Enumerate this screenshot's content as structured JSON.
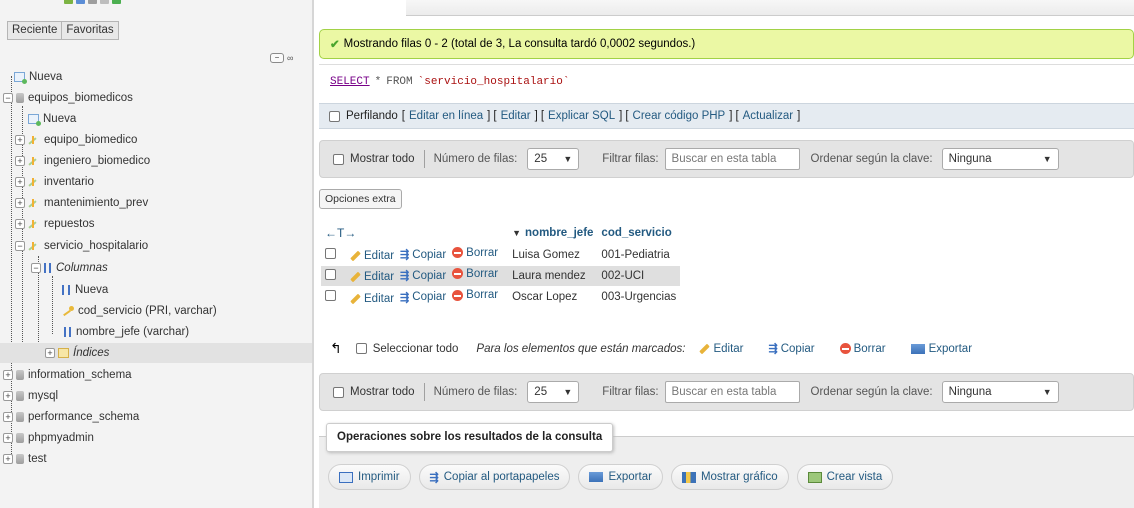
{
  "nav": {
    "tabs": [
      "Reciente",
      "Favoritas"
    ],
    "link_icon": "∞",
    "collapse_icon": "−",
    "tree": [
      {
        "label": "Nueva",
        "icon": "new-icon"
      },
      {
        "label": "equipos_biomedicos",
        "icon": "database-icon"
      },
      {
        "label": "Nueva",
        "icon": "new-icon"
      },
      {
        "label": "equipo_biomedico",
        "icon": "table-icon"
      },
      {
        "label": "ingeniero_biomedico",
        "icon": "table-icon"
      },
      {
        "label": "inventario",
        "icon": "table-icon"
      },
      {
        "label": "mantenimiento_prev",
        "icon": "table-icon"
      },
      {
        "label": "repuestos",
        "icon": "table-icon"
      },
      {
        "label": "servicio_hospitalario",
        "icon": "table-icon"
      },
      {
        "label": "Columnas",
        "icon": "columns-icon"
      },
      {
        "label": "Nueva",
        "icon": "new-icon"
      },
      {
        "label": "cod_servicio (PRI, varchar)",
        "icon": "key-icon"
      },
      {
        "label": "nombre_jefe (varchar)",
        "icon": "column-icon"
      },
      {
        "label": "Índices",
        "icon": "index-icon"
      },
      {
        "label": "information_schema",
        "icon": "database-icon"
      },
      {
        "label": "mysql",
        "icon": "database-icon"
      },
      {
        "label": "performance_schema",
        "icon": "database-icon"
      },
      {
        "label": "phpmyadmin",
        "icon": "database-icon"
      },
      {
        "label": "test",
        "icon": "database-icon"
      }
    ]
  },
  "message": "Mostrando filas 0 - 2 (total de 3, La consulta tardó 0,0002 segundos.)",
  "sql": {
    "select": "SELECT",
    "star": "*",
    "from": "FROM",
    "table": "`servicio_hospitalario`"
  },
  "profile": {
    "label": "Perfilando",
    "links": [
      "Editar en línea",
      "Editar",
      "Explicar SQL",
      "Crear código PHP",
      "Actualizar"
    ]
  },
  "navbar": {
    "show_all": "Mostrar todo",
    "rows_label": "Número de filas:",
    "rows_value": "25",
    "filter_label": "Filtrar filas:",
    "filter_placeholder": "Buscar en esta tabla",
    "sort_label": "Ordenar según la clave:",
    "sort_value": "Ninguna"
  },
  "extra_options": "Opciones extra",
  "table": {
    "arrows": "←T→",
    "sort_icon": "▼",
    "columns": [
      "nombre_jefe",
      "cod_servicio"
    ],
    "actions": [
      "Editar",
      "Copiar",
      "Borrar"
    ],
    "rows": [
      {
        "nombre_jefe": "Luisa Gomez",
        "cod_servicio": "001-Pediatria"
      },
      {
        "nombre_jefe": "Laura mendez",
        "cod_servicio": "002-UCI"
      },
      {
        "nombre_jefe": "Oscar Lopez",
        "cod_servicio": "003-Urgencias"
      }
    ]
  },
  "bulk": {
    "select_all": "Seleccionar todo",
    "marked_label": "Para los elementos que están marcados:",
    "actions": [
      "Editar",
      "Copiar",
      "Borrar",
      "Exportar"
    ]
  },
  "ops": {
    "legend": "Operaciones sobre los resultados de la consulta",
    "buttons": [
      "Imprimir",
      "Copiar al portapapeles",
      "Exportar",
      "Mostrar gráfico",
      "Crear vista"
    ]
  }
}
